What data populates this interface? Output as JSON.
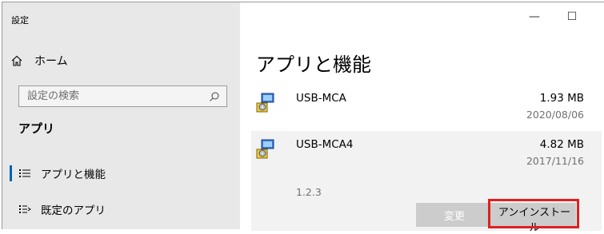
{
  "window": {
    "title": "設定"
  },
  "sidebar": {
    "home_label": "ホーム",
    "search_placeholder": "設定の検索",
    "section_title": "アプリ",
    "items": [
      {
        "label": "アプリと機能",
        "icon": "list-icon",
        "active": true
      },
      {
        "label": "既定のアプリ",
        "icon": "default-apps-icon",
        "active": false
      }
    ]
  },
  "controls": {
    "minimize": "—",
    "maximize": "☐",
    "close": "✕"
  },
  "main": {
    "title": "アプリと機能",
    "apps": [
      {
        "name": "USB-MCA",
        "size": "1.93 MB",
        "date": "2020/08/06"
      },
      {
        "name": "USB-MCA4",
        "size": "4.82 MB",
        "date": "2017/11/16",
        "version": "1.2.3",
        "modify_label": "変更",
        "uninstall_label": "アンインストール"
      }
    ]
  },
  "colors": {
    "accent": "#0063b1",
    "highlight": "#e02020",
    "sidebar_bg": "#e8e8e8"
  }
}
